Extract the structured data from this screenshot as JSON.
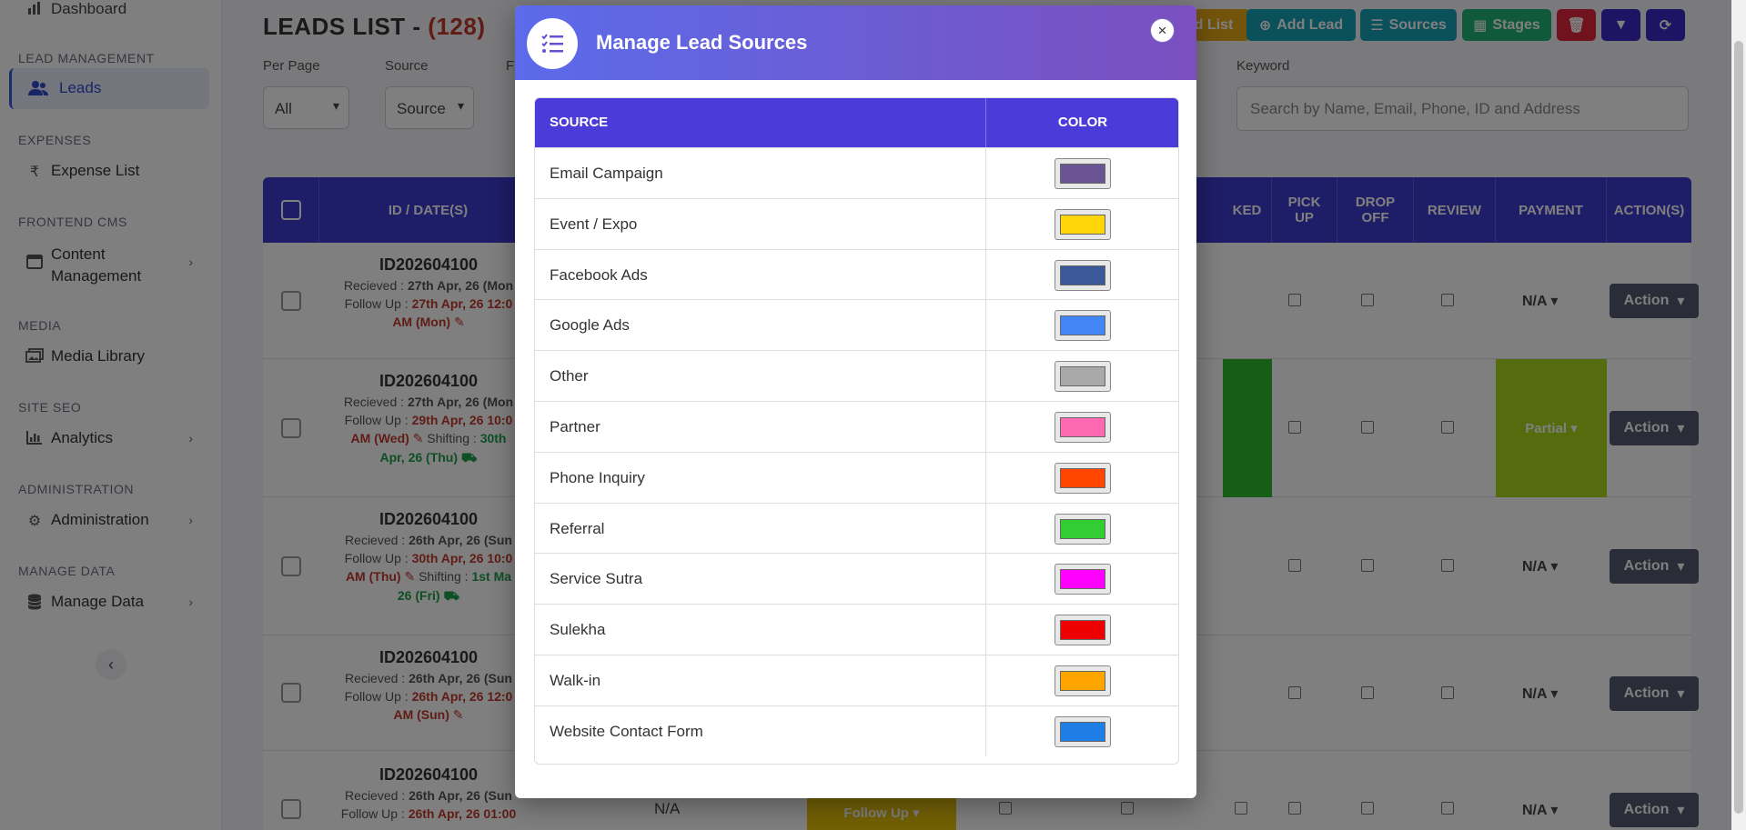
{
  "sidebar": {
    "dashboard": "Dashboard",
    "sections": [
      {
        "label": "LEAD MANAGEMENT"
      },
      {
        "label": "EXPENSES"
      },
      {
        "label": "FRONTEND CMS"
      },
      {
        "label": "MEDIA"
      },
      {
        "label": "SITE SEO"
      },
      {
        "label": "ADMINISTRATION"
      },
      {
        "label": "MANAGE DATA"
      }
    ],
    "items": {
      "leads": "Leads",
      "expense_list": "Expense List",
      "content_mgmt_1": "Content",
      "content_mgmt_2": "Management",
      "media_library": "Media Library",
      "analytics": "Analytics",
      "administration": "Administration",
      "manage_data": "Manage Data"
    }
  },
  "main": {
    "title": "LEADS LIST - ",
    "count": "(128)",
    "filters": {
      "per_page_label": "Per Page",
      "per_page_value": "All",
      "source_label": "Source",
      "source_value": "Source",
      "third_label": "F",
      "keyword_label": "Keyword",
      "keyword_placeholder": "Search by Name, Email, Phone, ID and Address"
    },
    "toolbar": {
      "list_label": "d List",
      "add_lead": "Add Lead",
      "sources": "Sources",
      "stages": "Stages"
    },
    "columns": {
      "id_date": "ID / DATE(S)",
      "booked": "KED",
      "pickup_1": "PICK",
      "pickup_2": "UP",
      "dropoff_1": "DROP",
      "dropoff_2": "OFF",
      "review": "REVIEW",
      "payment": "PAYMENT",
      "actions": "ACTION(S)"
    },
    "rows": [
      {
        "id": "ID202604100",
        "recieved_label": "Recieved : ",
        "recieved": "27th Apr, 26 (Mon",
        "follow_label": "Follow Up : ",
        "follow": "27th Apr, 26 12:0",
        "follow_2": "AM (Mon) ✎",
        "payment": "N/A",
        "action": "Action"
      },
      {
        "id": "ID202604100",
        "recieved_label": "Recieved : ",
        "recieved": "27th Apr, 26 (Mon",
        "follow_label": "Follow Up : ",
        "follow": "29th Apr, 26 10:0",
        "follow_2": "AM (Wed) ✎",
        "shifting_label": " Shifting : ",
        "shifting": "30th",
        "shifting_2": "Apr, 26 (Thu)",
        "payment": "Partial",
        "action": "Action"
      },
      {
        "id": "ID202604100",
        "recieved_label": "Recieved : ",
        "recieved": "26th Apr, 26 (Sun",
        "follow_label": "Follow Up : ",
        "follow": "30th Apr, 26 10:0",
        "follow_2": "AM (Thu) ✎",
        "shifting_label": " Shifting : ",
        "shifting": "1st Ma",
        "shifting_2": "26 (Fri)",
        "payment": "N/A",
        "action": "Action"
      },
      {
        "id": "ID202604100",
        "recieved_label": "Recieved : ",
        "recieved": "26th Apr, 26 (Sun",
        "follow_label": "Follow Up : ",
        "follow": "26th Apr, 26 12:0",
        "follow_2": "AM (Sun) ✎",
        "payment": "N/A",
        "action": "Action"
      },
      {
        "id": "ID202604100",
        "recieved_label": "Recieved : ",
        "recieved": "26th Apr, 26 (Sun",
        "follow_label": "Follow Up : ",
        "follow": "26th Apr, 26 01:00",
        "mid_na": "N/A",
        "stage": "Follow Up",
        "payment": "N/A",
        "action": "Action"
      }
    ]
  },
  "modal": {
    "title": "Manage Lead Sources",
    "col_source": "SOURCE",
    "col_color": "COLOR",
    "close": "×",
    "sources": [
      {
        "name": "Email Campaign",
        "color": "#6b5494"
      },
      {
        "name": "Event / Expo",
        "color": "#ffd60a"
      },
      {
        "name": "Facebook Ads",
        "color": "#3b5998"
      },
      {
        "name": "Google Ads",
        "color": "#4285f4"
      },
      {
        "name": "Other",
        "color": "#a9a9a9"
      },
      {
        "name": "Partner",
        "color": "#ff69b4"
      },
      {
        "name": "Phone Inquiry",
        "color": "#ff4500"
      },
      {
        "name": "Referral",
        "color": "#32cd32"
      },
      {
        "name": "Service Sutra",
        "color": "#ff00ff"
      },
      {
        "name": "Sulekha",
        "color": "#ee0000"
      },
      {
        "name": "Walk-in",
        "color": "#ffa500"
      },
      {
        "name": "Website Contact Form",
        "color": "#1e7ee6"
      }
    ]
  },
  "colors": {
    "accent": "#3d3bd1",
    "toolbar_orange": "#e6a817",
    "toolbar_teal": "#17a2b8",
    "toolbar_green": "#20b277",
    "toolbar_red": "#e0263c",
    "toolbar_indigo": "#3a28c9",
    "booked_green": "#2eb82e",
    "payment_partial": "#a8d81b",
    "stage_followup": "#e8c20a"
  }
}
